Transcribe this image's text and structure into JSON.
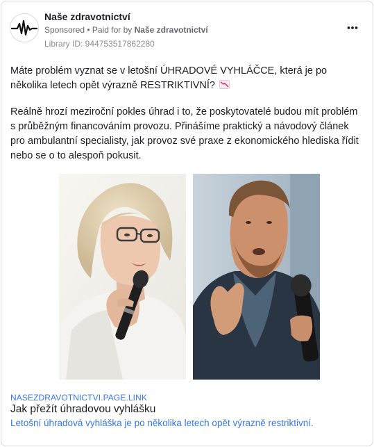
{
  "post": {
    "page_name": "Naše zdravotnictví",
    "sponsored": "Sponsored",
    "paid_for_prefix": " • Paid for by ",
    "paid_for_name": "Naše zdravotnictví",
    "library_id": "Library ID: 944753517862280",
    "more_icon": "more-horizontal-icon"
  },
  "body": {
    "paragraph1": "Máte problém vyznat se v letošní ÚHRADOVÉ VYHLÁČCE, která je po několika letech opět výrazně RESTRIKTIVNÍ?",
    "paragraph1_emoji": "chart-decreasing-icon",
    "paragraph2": "Reálně hrozí meziroční pokles úhrad i to, že poskytovatelé budou mít problém s průběžným financováním provozu. Přinášíme praktický a návodový článek pro ambulantní specialisty, jak provoz své praxe z ekonomického hlediska řídit nebo se o to alespoň pokusit."
  },
  "link_preview": {
    "domain": "NASEZDRAVOTNICTVI.PAGE.LINK",
    "title": "Jak přežít úhradovou vyhlášku",
    "description": "Letošní úhradová vyhláška je po několika letech opět výrazně restriktivní."
  },
  "colors": {
    "link_blue": "#3578e5",
    "text": "#1c1e21",
    "muted": "#65676b"
  }
}
